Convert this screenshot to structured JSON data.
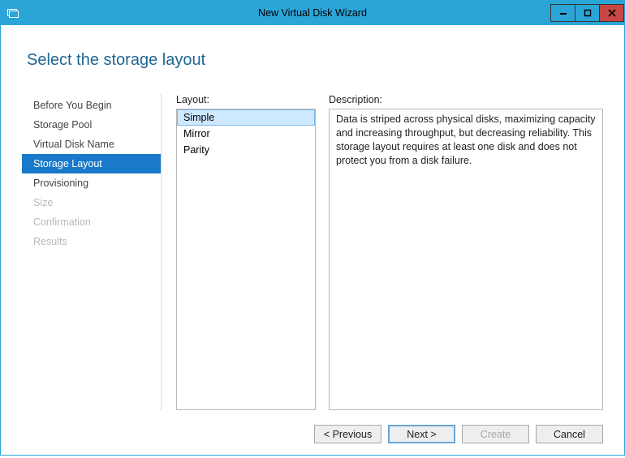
{
  "window": {
    "title": "New Virtual Disk Wizard"
  },
  "page": {
    "title": "Select the storage layout"
  },
  "sidebar": {
    "items": [
      {
        "label": "Before You Begin",
        "state": "enabled"
      },
      {
        "label": "Storage Pool",
        "state": "enabled"
      },
      {
        "label": "Virtual Disk Name",
        "state": "enabled"
      },
      {
        "label": "Storage Layout",
        "state": "selected"
      },
      {
        "label": "Provisioning",
        "state": "enabled"
      },
      {
        "label": "Size",
        "state": "disabled"
      },
      {
        "label": "Confirmation",
        "state": "disabled"
      },
      {
        "label": "Results",
        "state": "disabled"
      }
    ]
  },
  "layout": {
    "label": "Layout:",
    "items": [
      {
        "label": "Simple",
        "selected": true
      },
      {
        "label": "Mirror",
        "selected": false
      },
      {
        "label": "Parity",
        "selected": false
      }
    ]
  },
  "description": {
    "label": "Description:",
    "text": "Data is striped across physical disks, maximizing capacity and increasing throughput, but decreasing reliability. This storage layout requires at least one disk and does not protect you from a disk failure."
  },
  "buttons": {
    "previous": "< Previous",
    "next": "Next >",
    "create": "Create",
    "cancel": "Cancel"
  }
}
